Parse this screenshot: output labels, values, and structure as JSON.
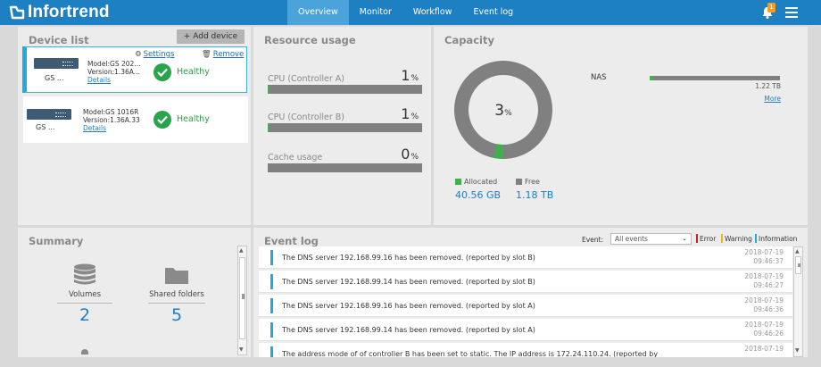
{
  "app": {
    "brand": "Infortrend",
    "nav": [
      {
        "label": "Overview",
        "active": true
      },
      {
        "label": "Monitor",
        "active": false
      },
      {
        "label": "Workflow",
        "active": false
      },
      {
        "label": "Event log",
        "active": false
      }
    ],
    "notification_count": "1"
  },
  "device_list": {
    "title": "Device list",
    "add_button": "+ Add device",
    "settings_label": "Settings",
    "remove_label": "Remove",
    "devices": [
      {
        "name": "GS ...",
        "model": "Model:GS 202...",
        "version": "Version:1.36A...",
        "details": "Details",
        "status": "Healthy"
      },
      {
        "name": "GS ...",
        "model": "Model:GS 1016R",
        "version": "Version:1.36A.33",
        "details": "Details",
        "status": "Healthy"
      }
    ]
  },
  "resource_usage": {
    "title": "Resource usage",
    "items": [
      {
        "label": "CPU (Controller A)",
        "value": "1",
        "unit": "%",
        "percent": 1
      },
      {
        "label": "CPU (Controller B)",
        "value": "1",
        "unit": "%",
        "percent": 1
      },
      {
        "label": "Cache usage",
        "value": "0",
        "unit": "%",
        "percent": 0
      }
    ]
  },
  "capacity": {
    "title": "Capacity",
    "percent": "3",
    "unit": "%",
    "used_fraction": 0.03,
    "allocated_label": "Allocated",
    "allocated_value": "40.56 GB",
    "free_label": "Free",
    "free_value": "1.18 TB",
    "nas_label": "NAS",
    "nas_size": "1.22 TB",
    "nas_fraction": 0.03,
    "more_label": "More",
    "colors": {
      "allocated": "#3db24a",
      "free": "#808080"
    }
  },
  "summary": {
    "title": "Summary",
    "items": [
      {
        "label": "Volumes",
        "value": "2",
        "icon": "database-icon"
      },
      {
        "label": "Shared folders",
        "value": "5",
        "icon": "folder-icon"
      }
    ]
  },
  "event_log": {
    "title": "Event log",
    "filter_label": "Event:",
    "filter_value": "All events",
    "types": {
      "error": "Error",
      "warning": "Warning",
      "information": "Information"
    },
    "events": [
      {
        "message": "The DNS server 192.168.99.16 has been removed. (reported by slot B)",
        "date": "2018-07-19",
        "time": "09:46:37"
      },
      {
        "message": "The DNS server 192.168.99.14 has been removed. (reported by slot B)",
        "date": "2018-07-19",
        "time": "09:46:27"
      },
      {
        "message": "The DNS server 192.168.99.16 has been removed. (reported by slot A)",
        "date": "2018-07-19",
        "time": "09:46:36"
      },
      {
        "message": "The DNS server 192.168.99.14 has been removed. (reported by slot A)",
        "date": "2018-07-19",
        "time": "09:46:26"
      },
      {
        "message": "The address mode of of controller B has been set to static. The IP address is 172.24.110.24. (reported by",
        "date": "2018-07-19",
        "time": ""
      }
    ]
  }
}
